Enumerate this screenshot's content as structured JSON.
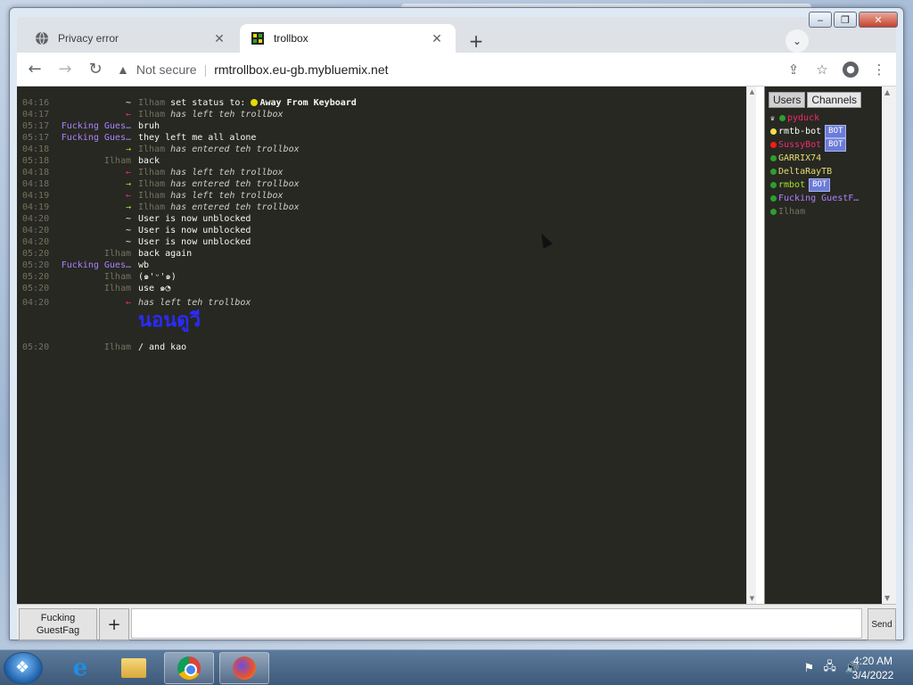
{
  "browser": {
    "tabs": [
      {
        "title": "Privacy error",
        "active": false
      },
      {
        "title": "trollbox",
        "active": true
      }
    ],
    "address": {
      "security_label": "Not secure",
      "url": "rmtrollbox.eu-gb.mybluemix.net"
    }
  },
  "chat": {
    "messages": [
      {
        "time": "04:16",
        "nick": "~",
        "parts": [
          {
            "t": "Ilham",
            "c": "dim"
          },
          {
            "t": " set status to: ",
            "c": "white"
          },
          {
            "t": "Away From Keyboard",
            "c": "white bold",
            "dot": true
          }
        ]
      },
      {
        "time": "04:17",
        "nick": "←",
        "nick_color": "red",
        "parts": [
          {
            "t": "Ilham",
            "c": "dim"
          },
          {
            "t": " has left teh trollbox",
            "c": "it"
          }
        ]
      },
      {
        "time": "05:17",
        "nick": "Fucking Gues…",
        "nick_color": "guest",
        "parts": [
          {
            "t": "bruh",
            "c": "white"
          }
        ]
      },
      {
        "time": "05:17",
        "nick": "Fucking Gues…",
        "nick_color": "guest",
        "parts": [
          {
            "t": "they left me all alone",
            "c": "white"
          }
        ]
      },
      {
        "time": "04:18",
        "nick": "→",
        "nick_color": "green",
        "parts": [
          {
            "t": "Ilham",
            "c": "dim"
          },
          {
            "t": " has entered teh trollbox",
            "c": "it"
          }
        ]
      },
      {
        "time": "05:18",
        "nick": "Ilham",
        "nick_color": "user",
        "parts": [
          {
            "t": "back",
            "c": "white"
          }
        ]
      },
      {
        "time": "04:18",
        "nick": "←",
        "nick_color": "red",
        "parts": [
          {
            "t": "Ilham",
            "c": "dim"
          },
          {
            "t": " has left teh trollbox",
            "c": "it"
          }
        ]
      },
      {
        "time": "04:18",
        "nick": "→",
        "nick_color": "green",
        "parts": [
          {
            "t": "Ilham",
            "c": "dim"
          },
          {
            "t": " has entered teh trollbox",
            "c": "it"
          }
        ]
      },
      {
        "time": "04:19",
        "nick": "←",
        "nick_color": "red",
        "parts": [
          {
            "t": "Ilham",
            "c": "dim"
          },
          {
            "t": " has left teh trollbox",
            "c": "it"
          }
        ]
      },
      {
        "time": "04:19",
        "nick": "→",
        "nick_color": "green",
        "parts": [
          {
            "t": "Ilham",
            "c": "dim"
          },
          {
            "t": " has entered teh trollbox",
            "c": "it"
          }
        ]
      },
      {
        "time": "04:20",
        "nick": "~",
        "nick_color": "white",
        "parts": [
          {
            "t": "User is now unblocked",
            "c": "white"
          }
        ]
      },
      {
        "time": "04:20",
        "nick": "~",
        "nick_color": "white",
        "parts": [
          {
            "t": "User is now unblocked",
            "c": "white"
          }
        ]
      },
      {
        "time": "04:20",
        "nick": "~",
        "nick_color": "white",
        "parts": [
          {
            "t": "User is now unblocked",
            "c": "white"
          }
        ]
      },
      {
        "time": "05:20",
        "nick": "Ilham",
        "nick_color": "user",
        "parts": [
          {
            "t": "back again",
            "c": "white"
          }
        ]
      },
      {
        "time": "05:20",
        "nick": "Fucking Gues…",
        "nick_color": "guest",
        "parts": [
          {
            "t": "wb",
            "c": "white"
          }
        ]
      },
      {
        "time": "05:20",
        "nick": "Ilham",
        "nick_color": "user",
        "parts": [
          {
            "t": "(๑'ᵕ'๑)",
            "c": "white"
          }
        ]
      },
      {
        "time": "05:20",
        "nick": "Ilham",
        "nick_color": "user",
        "parts": [
          {
            "t": "use ๑◔",
            "c": "white"
          }
        ]
      },
      {
        "time": "04:20",
        "nick": "←",
        "nick_color": "red",
        "parts": [
          {
            "t": "                  has left teh trollbox",
            "c": "it"
          }
        ]
      }
    ],
    "big_text": "นอนดูวี",
    "last_message": {
      "time": "05:20",
      "nick": "Ilham",
      "text": "/ and kao"
    }
  },
  "users_panel": {
    "tab_users": "Users",
    "tab_channels": "Channels",
    "users": [
      {
        "name": "pyduck",
        "color": "#f92672",
        "dot": "#2e9e2e",
        "crown": true,
        "bot": false
      },
      {
        "name": "rmtb-bot",
        "color": "#ffffff",
        "dot": "#f4e04d",
        "bot": true
      },
      {
        "name": "SussyBot",
        "color": "#f92672",
        "dot": "#ff1a1a",
        "bot": true
      },
      {
        "name": "GARRIX74",
        "color": "#e6db74",
        "dot": "#2e9e2e",
        "bot": false
      },
      {
        "name": "DeltaRayTB",
        "color": "#e6db74",
        "dot": "#2e9e2e",
        "bot": false
      },
      {
        "name": "rmbot",
        "color": "#a6e22e",
        "dot": "#2e9e2e",
        "bot": true
      },
      {
        "name": "Fucking GuestF…",
        "color": "#ae81ff",
        "dot": "#2e9e2e",
        "bot": false
      },
      {
        "name": "Ilham",
        "color": "#75715e",
        "dot": "#2e9e2e",
        "bot": false
      }
    ],
    "bot_label": "BOT"
  },
  "input": {
    "nick_line1": "Fucking",
    "nick_line2": "GuestFag",
    "add_label": "+",
    "send_label": "Send"
  },
  "taskbar": {
    "time": "4:20 AM",
    "date": "3/4/2022"
  }
}
